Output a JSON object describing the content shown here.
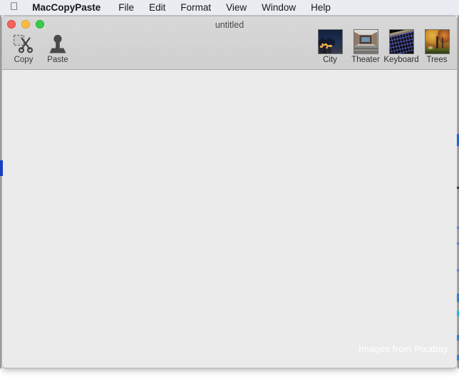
{
  "menubar": {
    "apple_icon": "apple-logo-icon",
    "items": [
      {
        "label": "MacCopyPaste",
        "bold": true
      },
      {
        "label": "File"
      },
      {
        "label": "Edit"
      },
      {
        "label": "Format"
      },
      {
        "label": "View"
      },
      {
        "label": "Window"
      },
      {
        "label": "Help"
      }
    ]
  },
  "window": {
    "title": "untitled",
    "traffic_lights": {
      "close": "close-button",
      "minimize": "minimize-button",
      "maximize": "maximize-button"
    }
  },
  "toolbar": {
    "tools": [
      {
        "label": "Copy",
        "icon": "scissors-icon"
      },
      {
        "label": "Paste",
        "icon": "stamp-icon"
      }
    ],
    "images": [
      {
        "label": "City",
        "icon": "city-thumbnail"
      },
      {
        "label": "Theater",
        "icon": "theater-thumbnail"
      },
      {
        "label": "Keyboard",
        "icon": "keyboard-thumbnail"
      },
      {
        "label": "Trees",
        "icon": "trees-thumbnail"
      }
    ]
  },
  "content": {
    "watermark": "Images from Pixabay"
  },
  "colors": {
    "menubar_bg": "#e9edf2",
    "toolbar_bg": "#d2d2d2",
    "content_bg": "#ebebeb",
    "marker_blue": "#1a3fc4",
    "close_red": "#f5655b",
    "minimize_yellow": "#fdbc40",
    "maximize_green": "#35cd4b",
    "watermark_text": "#ffffff"
  }
}
